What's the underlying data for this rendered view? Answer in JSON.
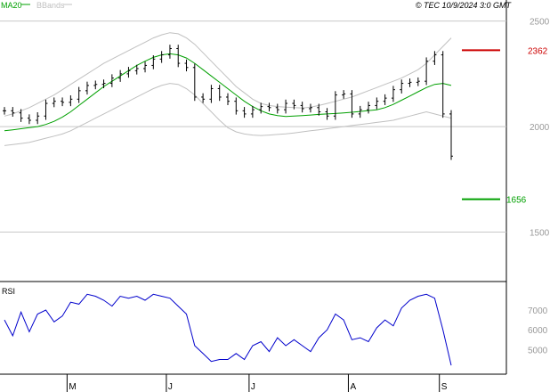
{
  "header": {
    "legend_ma": "MA20",
    "legend_bb": "BBands",
    "copyright": "© TEC 10/9/2024 3:0 GMT"
  },
  "colors": {
    "price": "#000000",
    "ma": "#00a000",
    "bands": "#c0c0c0",
    "rsi": "#0000cc",
    "resistance": "#cc0000",
    "support": "#00a000",
    "grid": "#c8c8c8",
    "axis": "#000000"
  },
  "chart_data": [
    {
      "type": "line",
      "title": "",
      "x_ticks": [
        "M",
        "J",
        "J",
        "A",
        "S"
      ],
      "y_ticks": [
        "2500",
        "2000",
        "1500"
      ],
      "ylim": [
        1270,
        2600
      ],
      "grid": true,
      "legend": "top-left",
      "series": [
        {
          "name": "MA20",
          "values": [
            1980,
            1985,
            1990,
            1995,
            2000,
            2010,
            2025,
            2045,
            2070,
            2100,
            2130,
            2160,
            2190,
            2215,
            2240,
            2265,
            2290,
            2310,
            2328,
            2340,
            2345,
            2340,
            2325,
            2300,
            2270,
            2240,
            2210,
            2180,
            2150,
            2120,
            2095,
            2075,
            2060,
            2052,
            2048,
            2050,
            2052,
            2055,
            2058,
            2060,
            2062,
            2065,
            2068,
            2072,
            2076,
            2080,
            2090,
            2105,
            2125,
            2145,
            2165,
            2185,
            2200,
            2205,
            2195
          ]
        },
        {
          "name": "BBands-upper",
          "values": [
            2050,
            2060,
            2075,
            2090,
            2110,
            2130,
            2150,
            2175,
            2200,
            2225,
            2250,
            2275,
            2300,
            2320,
            2340,
            2360,
            2380,
            2400,
            2420,
            2435,
            2445,
            2440,
            2420,
            2390,
            2350,
            2310,
            2270,
            2230,
            2190,
            2160,
            2130,
            2110,
            2100,
            2095,
            2092,
            2090,
            2088,
            2092,
            2100,
            2110,
            2120,
            2130,
            2140,
            2155,
            2170,
            2185,
            2200,
            2215,
            2230,
            2250,
            2270,
            2300,
            2340,
            2380,
            2420
          ]
        },
        {
          "name": "BBands-lower",
          "values": [
            1910,
            1915,
            1920,
            1925,
            1935,
            1945,
            1955,
            1965,
            1980,
            2000,
            2020,
            2040,
            2060,
            2080,
            2100,
            2120,
            2140,
            2160,
            2180,
            2195,
            2205,
            2200,
            2180,
            2150,
            2110,
            2070,
            2030,
            1995,
            1975,
            1965,
            1960,
            1958,
            1960,
            1963,
            1966,
            1970,
            1975,
            1980,
            1985,
            1990,
            1995,
            2000,
            2005,
            2010,
            2015,
            2020,
            2025,
            2030,
            2040,
            2050,
            2060,
            2070,
            2060,
            2050,
            2040
          ]
        },
        {
          "name": "Price",
          "values": [
            2075,
            2065,
            2040,
            2030,
            2050,
            2110,
            2120,
            2115,
            2130,
            2170,
            2195,
            2200,
            2205,
            2230,
            2250,
            2265,
            2275,
            2290,
            2320,
            2340,
            2370,
            2300,
            2280,
            2140,
            2130,
            2180,
            2140,
            2120,
            2075,
            2060,
            2080,
            2095,
            2090,
            2080,
            2110,
            2100,
            2085,
            2090,
            2070,
            2050,
            2150,
            2155,
            2060,
            2080,
            2100,
            2120,
            2135,
            2175,
            2205,
            2210,
            2215,
            2310,
            2340,
            2060,
            1860
          ]
        }
      ],
      "annotations": [
        {
          "label": "2362",
          "value": 2362,
          "kind": "resistance"
        },
        {
          "label": "1656",
          "value": 1656,
          "kind": "support"
        }
      ]
    },
    {
      "type": "line",
      "title": "RSI",
      "y_ticks": [
        "7000",
        "6000",
        "5000"
      ],
      "ylim": [
        3800,
        8400
      ],
      "series": [
        {
          "name": "RSI",
          "values": [
            6500,
            5700,
            6900,
            5900,
            6800,
            7000,
            6400,
            6700,
            7400,
            7300,
            7800,
            7700,
            7500,
            7200,
            7700,
            7600,
            7700,
            7500,
            7800,
            7700,
            7600,
            7200,
            6800,
            5200,
            4800,
            4400,
            4500,
            4500,
            4800,
            4500,
            5200,
            5400,
            4900,
            5600,
            5200,
            5500,
            5200,
            4900,
            5600,
            6000,
            6800,
            6500,
            5500,
            5600,
            5400,
            6100,
            6500,
            6200,
            7100,
            7500,
            7700,
            7800,
            7600,
            6000,
            4200
          ]
        }
      ]
    }
  ]
}
